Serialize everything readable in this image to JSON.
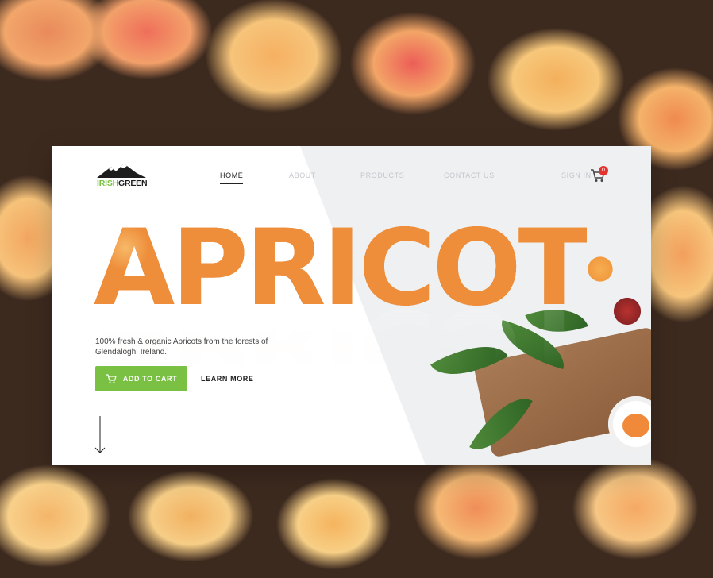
{
  "brand": {
    "name_part1": "IRISH",
    "name_part2": "GREEN",
    "accent_color": "#7ac143",
    "icon": "mountain-logo-icon"
  },
  "nav": {
    "items": [
      {
        "label": "HOME",
        "active": true
      },
      {
        "label": "ABOUT",
        "active": false
      },
      {
        "label": "PRODUCTS",
        "active": false
      },
      {
        "label": "CONTACT US",
        "active": false
      }
    ],
    "signin_label": "SIGN IN",
    "cart_icon": "cart-icon",
    "cart_count": "0",
    "badge_color": "#e5322d"
  },
  "hero": {
    "word": "APRICOT",
    "tagline": "100% fresh & organic Apricots from the forests of Glendalogh, Ireland.",
    "add_to_cart_label": "ADD TO CART",
    "learn_more_label": "LEARN MORE",
    "scroll_icon": "arrow-down-icon"
  }
}
